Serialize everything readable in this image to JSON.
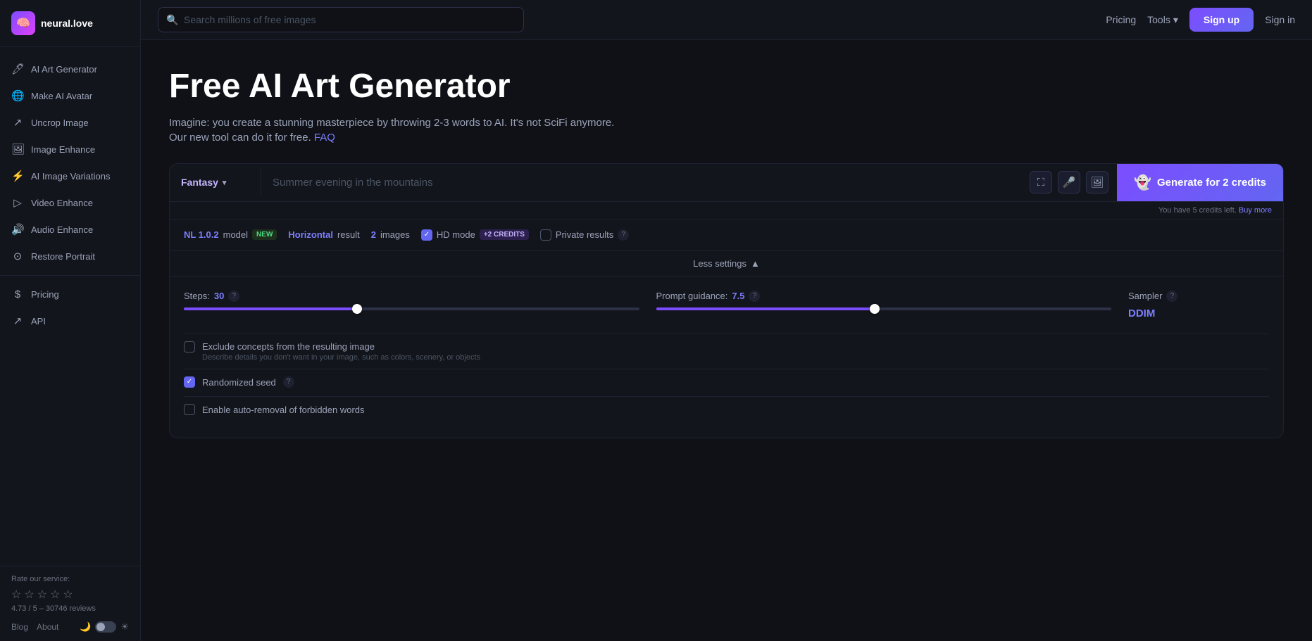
{
  "app": {
    "name": "neural",
    "name2": ".love"
  },
  "topnav": {
    "search_placeholder": "Search millions of free images",
    "pricing_label": "Pricing",
    "tools_label": "Tools",
    "signup_label": "Sign up",
    "signin_label": "Sign in"
  },
  "sidebar": {
    "items": [
      {
        "id": "ai-art-generator",
        "label": "AI Art Generator",
        "icon": "🖊"
      },
      {
        "id": "make-ai-avatar",
        "label": "Make AI Avatar",
        "icon": "🌐"
      },
      {
        "id": "uncrop-image",
        "label": "Uncrop Image",
        "icon": "↗"
      },
      {
        "id": "image-enhance",
        "label": "Image Enhance",
        "icon": "🖼"
      },
      {
        "id": "ai-image-variations",
        "label": "AI Image Variations",
        "icon": "⚡"
      },
      {
        "id": "video-enhance",
        "label": "Video Enhance",
        "icon": "▷"
      },
      {
        "id": "audio-enhance",
        "label": "Audio Enhance",
        "icon": "🔊"
      },
      {
        "id": "restore-portrait",
        "label": "Restore Portrait",
        "icon": "⊙"
      }
    ],
    "pricing": {
      "label": "Pricing",
      "icon": "$"
    },
    "api": {
      "label": "API",
      "icon": "↗"
    }
  },
  "footer": {
    "rate_label": "Rate our service:",
    "rating_text": "4.73 / 5 – 30746 reviews",
    "blog_label": "Blog",
    "about_label": "About"
  },
  "page": {
    "title": "Free AI Art Generator",
    "subtitle": "Imagine: you create a stunning masterpiece by throwing 2-3 words to AI. It's not SciFi anymore.",
    "subtitle2": "Our new tool can do it for free.",
    "faq_link": "FAQ"
  },
  "generator": {
    "style_label": "Fantasy",
    "prompt_placeholder": "Summer evening in the mountains",
    "generate_label": "Generate for 2 credits",
    "credits_info": "You have 5 credits left.",
    "buy_more_label": "Buy more",
    "model_label": "model",
    "model_value": "NL 1.0.2",
    "model_badge": "NEW",
    "result_label": "result",
    "result_value": "Horizontal",
    "images_label": "images",
    "images_value": "2",
    "hd_mode_label": "HD mode",
    "hd_badge": "+2 CREDITS",
    "private_results_label": "Private results",
    "less_settings_label": "Less settings",
    "steps_label": "Steps:",
    "steps_value": "30",
    "guidance_label": "Prompt guidance:",
    "guidance_value": "7.5",
    "sampler_label": "Sampler",
    "sampler_value": "DDIM",
    "steps_percent": 38,
    "guidance_percent": 48,
    "exclude_label": "Exclude concepts from the resulting image",
    "exclude_sublabel": "Describe details you don't want in your image, such as colors, scenery, or objects",
    "randomized_seed_label": "Randomized seed",
    "forbidden_words_label": "Enable auto-removal of forbidden words"
  }
}
